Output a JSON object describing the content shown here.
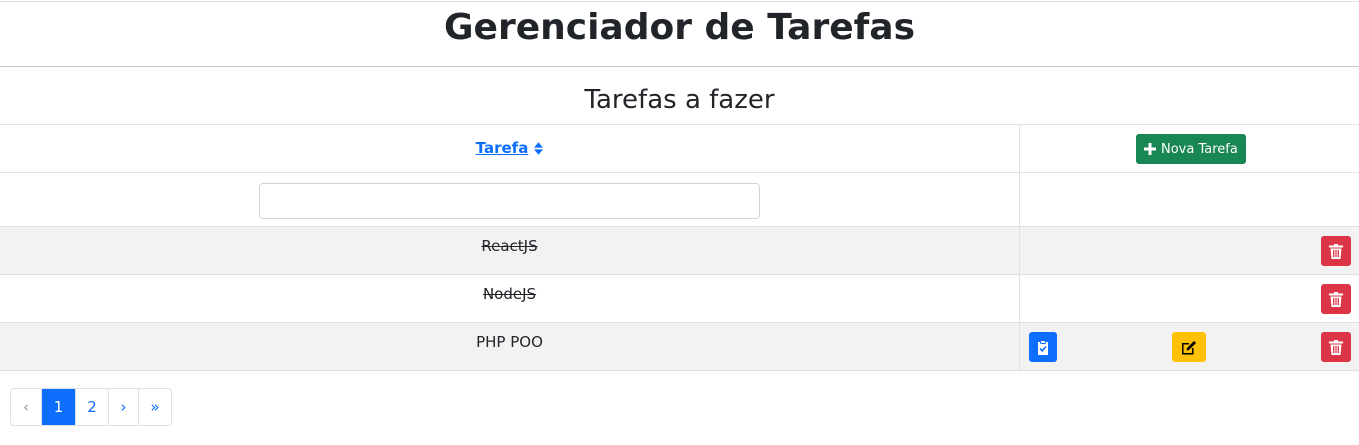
{
  "header": {
    "title": "Gerenciador de Tarefas"
  },
  "section": {
    "title": "Tarefas a fazer"
  },
  "table": {
    "column_task": "Tarefa",
    "new_task_label": "Nova Tarefa",
    "filter": {
      "value": "",
      "placeholder": ""
    },
    "rows": [
      {
        "name": "ReactJS",
        "done": true
      },
      {
        "name": "NodeJS",
        "done": true
      },
      {
        "name": "PHP POO",
        "done": false
      }
    ]
  },
  "pagination": {
    "prev": "‹",
    "pages": [
      "1",
      "2"
    ],
    "active": "1",
    "next": "›",
    "last": "»"
  },
  "colors": {
    "primary": "#0d6efd",
    "success": "#198754",
    "danger": "#dc3545",
    "warning": "#ffc107",
    "stripe": "#f2f2f2"
  },
  "icons": [
    "sort-icon",
    "plus-icon",
    "trash-icon",
    "clipboard-check-icon",
    "edit-icon"
  ]
}
